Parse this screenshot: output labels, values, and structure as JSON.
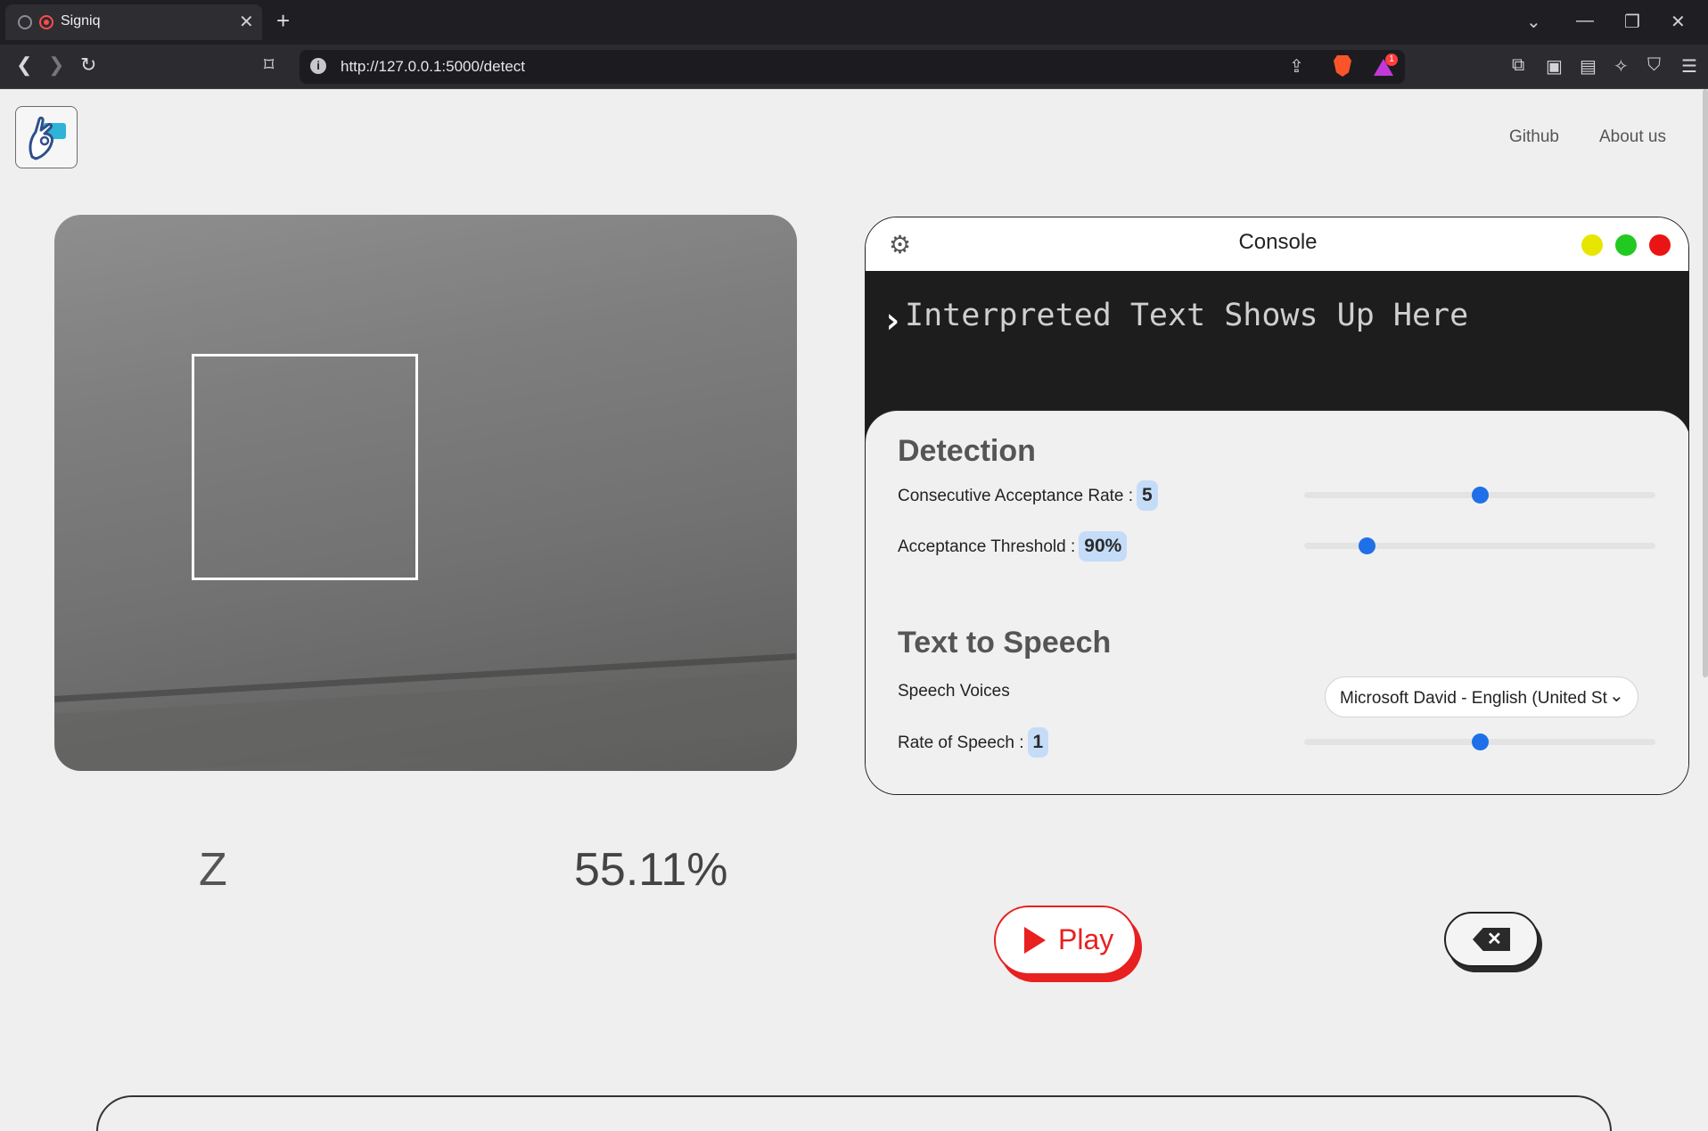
{
  "browser": {
    "tab_title": "Signiq",
    "url": "http://127.0.0.1:5000/detect",
    "shield_badge_count": "1"
  },
  "header": {
    "nav": [
      "Github",
      "About us"
    ]
  },
  "camera": {
    "prediction_letter": "Z",
    "prediction_confidence": "55.11%"
  },
  "console": {
    "title": "Console",
    "placeholder_text": "Interpreted Text Shows Up Here",
    "window_dots": [
      "#e6e600",
      "#22c922",
      "#ea1414"
    ],
    "detection": {
      "title": "Detection",
      "consecutive_label": "Consecutive Acceptance Rate :",
      "consecutive_value": "5",
      "consecutive_slider_fraction": 0.5,
      "threshold_label": "Acceptance Threshold :",
      "threshold_value": "90%",
      "threshold_slider_fraction": 0.18
    },
    "tts": {
      "title": "Text to Speech",
      "voices_label": "Speech Voices",
      "voice_selected": "Microsoft David - English (United States)",
      "rate_label": "Rate of Speech :",
      "rate_value": "1",
      "rate_slider_fraction": 0.5
    }
  },
  "controls": {
    "play_label": "Play"
  },
  "colors": {
    "accent_red": "#e82020",
    "slider_blue": "#1f6fe8",
    "pill_bg": "#c5dcf8"
  }
}
